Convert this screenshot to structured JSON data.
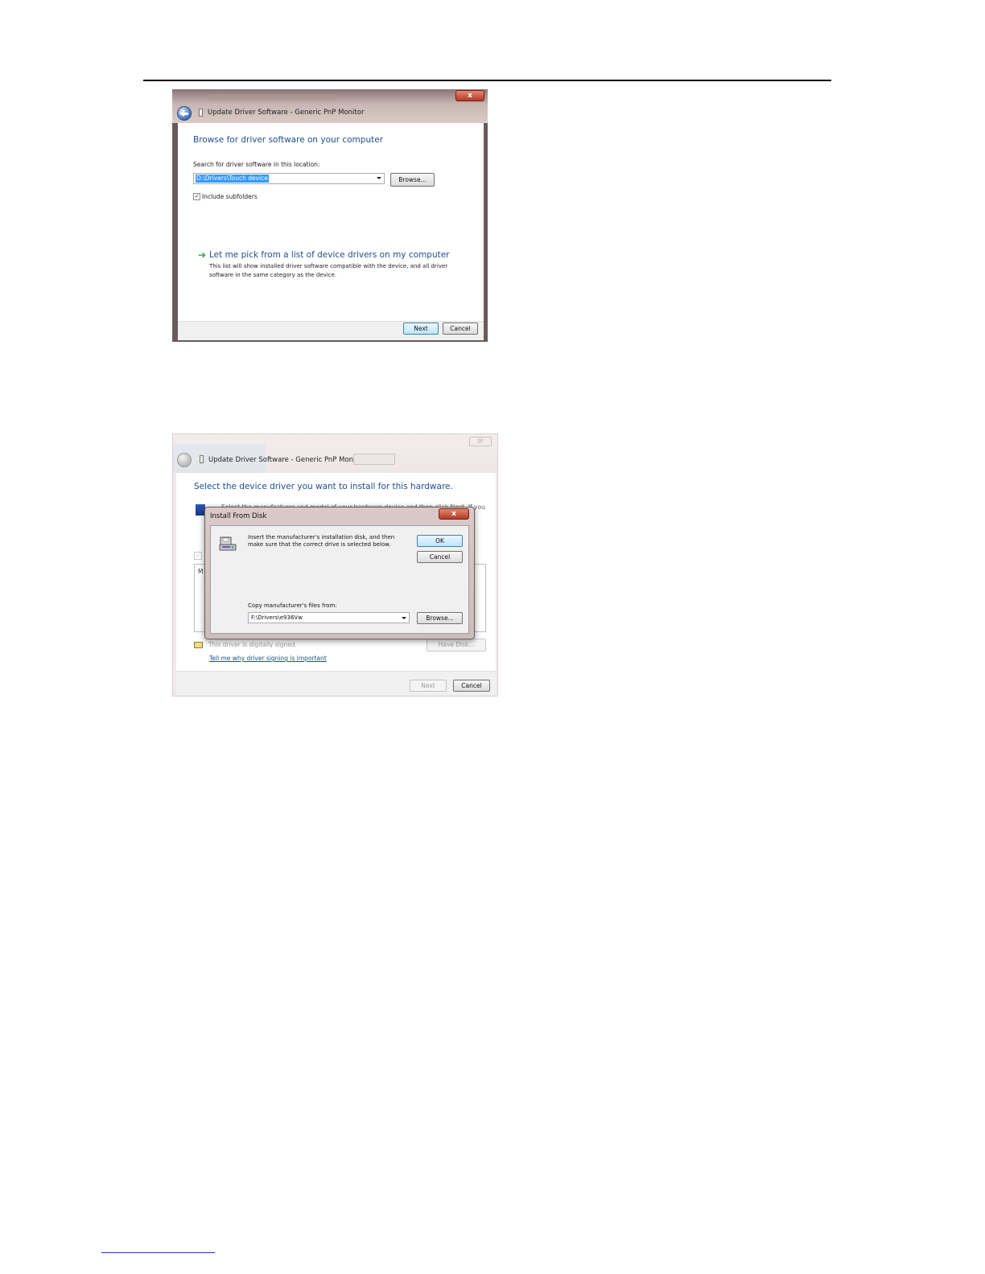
{
  "shot1": {
    "window_title": "Update Driver Software - Generic PnP Monitor",
    "close_glyph": "x",
    "heading": "Browse for driver software on your computer",
    "search_label": "Search for driver software in this location:",
    "location_value": "D:\\Drivers\\Touch device",
    "browse_label": "Browse...",
    "include_subfolders_label": "Include subfolders",
    "include_subfolders_checked": true,
    "check_glyph": "✓",
    "arrow_glyph": "➔",
    "pick_link": "Let me pick from a list of device drivers on my computer",
    "pick_description": "This list will show installed driver software compatible with the device, and all driver software in the same category as the device.",
    "next_label": "Next",
    "cancel_label": "Cancel"
  },
  "shot2": {
    "window_title": "Update Driver Software - Generic PnP Monitor",
    "bg_close_glyph": "☒",
    "heading": "Select the device driver you want to install for this hardware.",
    "partial_instruction": "Select the manufacturer and model of your hardware device and then click Next. If you",
    "bg_check_glyph": "✓",
    "list_partial_text": "M",
    "signed_text": "This driver is digitally signed.",
    "have_disk_label": "Have Disk...",
    "signing_link": "Tell me why driver signing is important",
    "next_label": "Next",
    "cancel_label": "Cancel",
    "modal": {
      "title": "Install From Disk",
      "close_glyph": "x",
      "message": "Insert the manufacturer's installation disk, and then make sure that the correct drive is selected below.",
      "ok_label": "OK",
      "cancel_label": "Cancel",
      "copy_label": "Copy manufacturer's files from:",
      "copy_value": "F:\\Drivers\\e936Vw",
      "browse_label": "Browse..."
    }
  },
  "colors": {
    "heading_blue": "#1e4e8c",
    "link_blue": "#1a4fa0",
    "selection_blue": "#3399ff",
    "close_red": "#b53a26",
    "arrow_green": "#2ea04a"
  },
  "icons": [
    "back-arrow-icon",
    "document-icon",
    "close-icon",
    "dropdown-arrow-icon",
    "green-arrow-icon",
    "monitor-icon",
    "certificate-icon",
    "disk-drive-icon"
  ]
}
